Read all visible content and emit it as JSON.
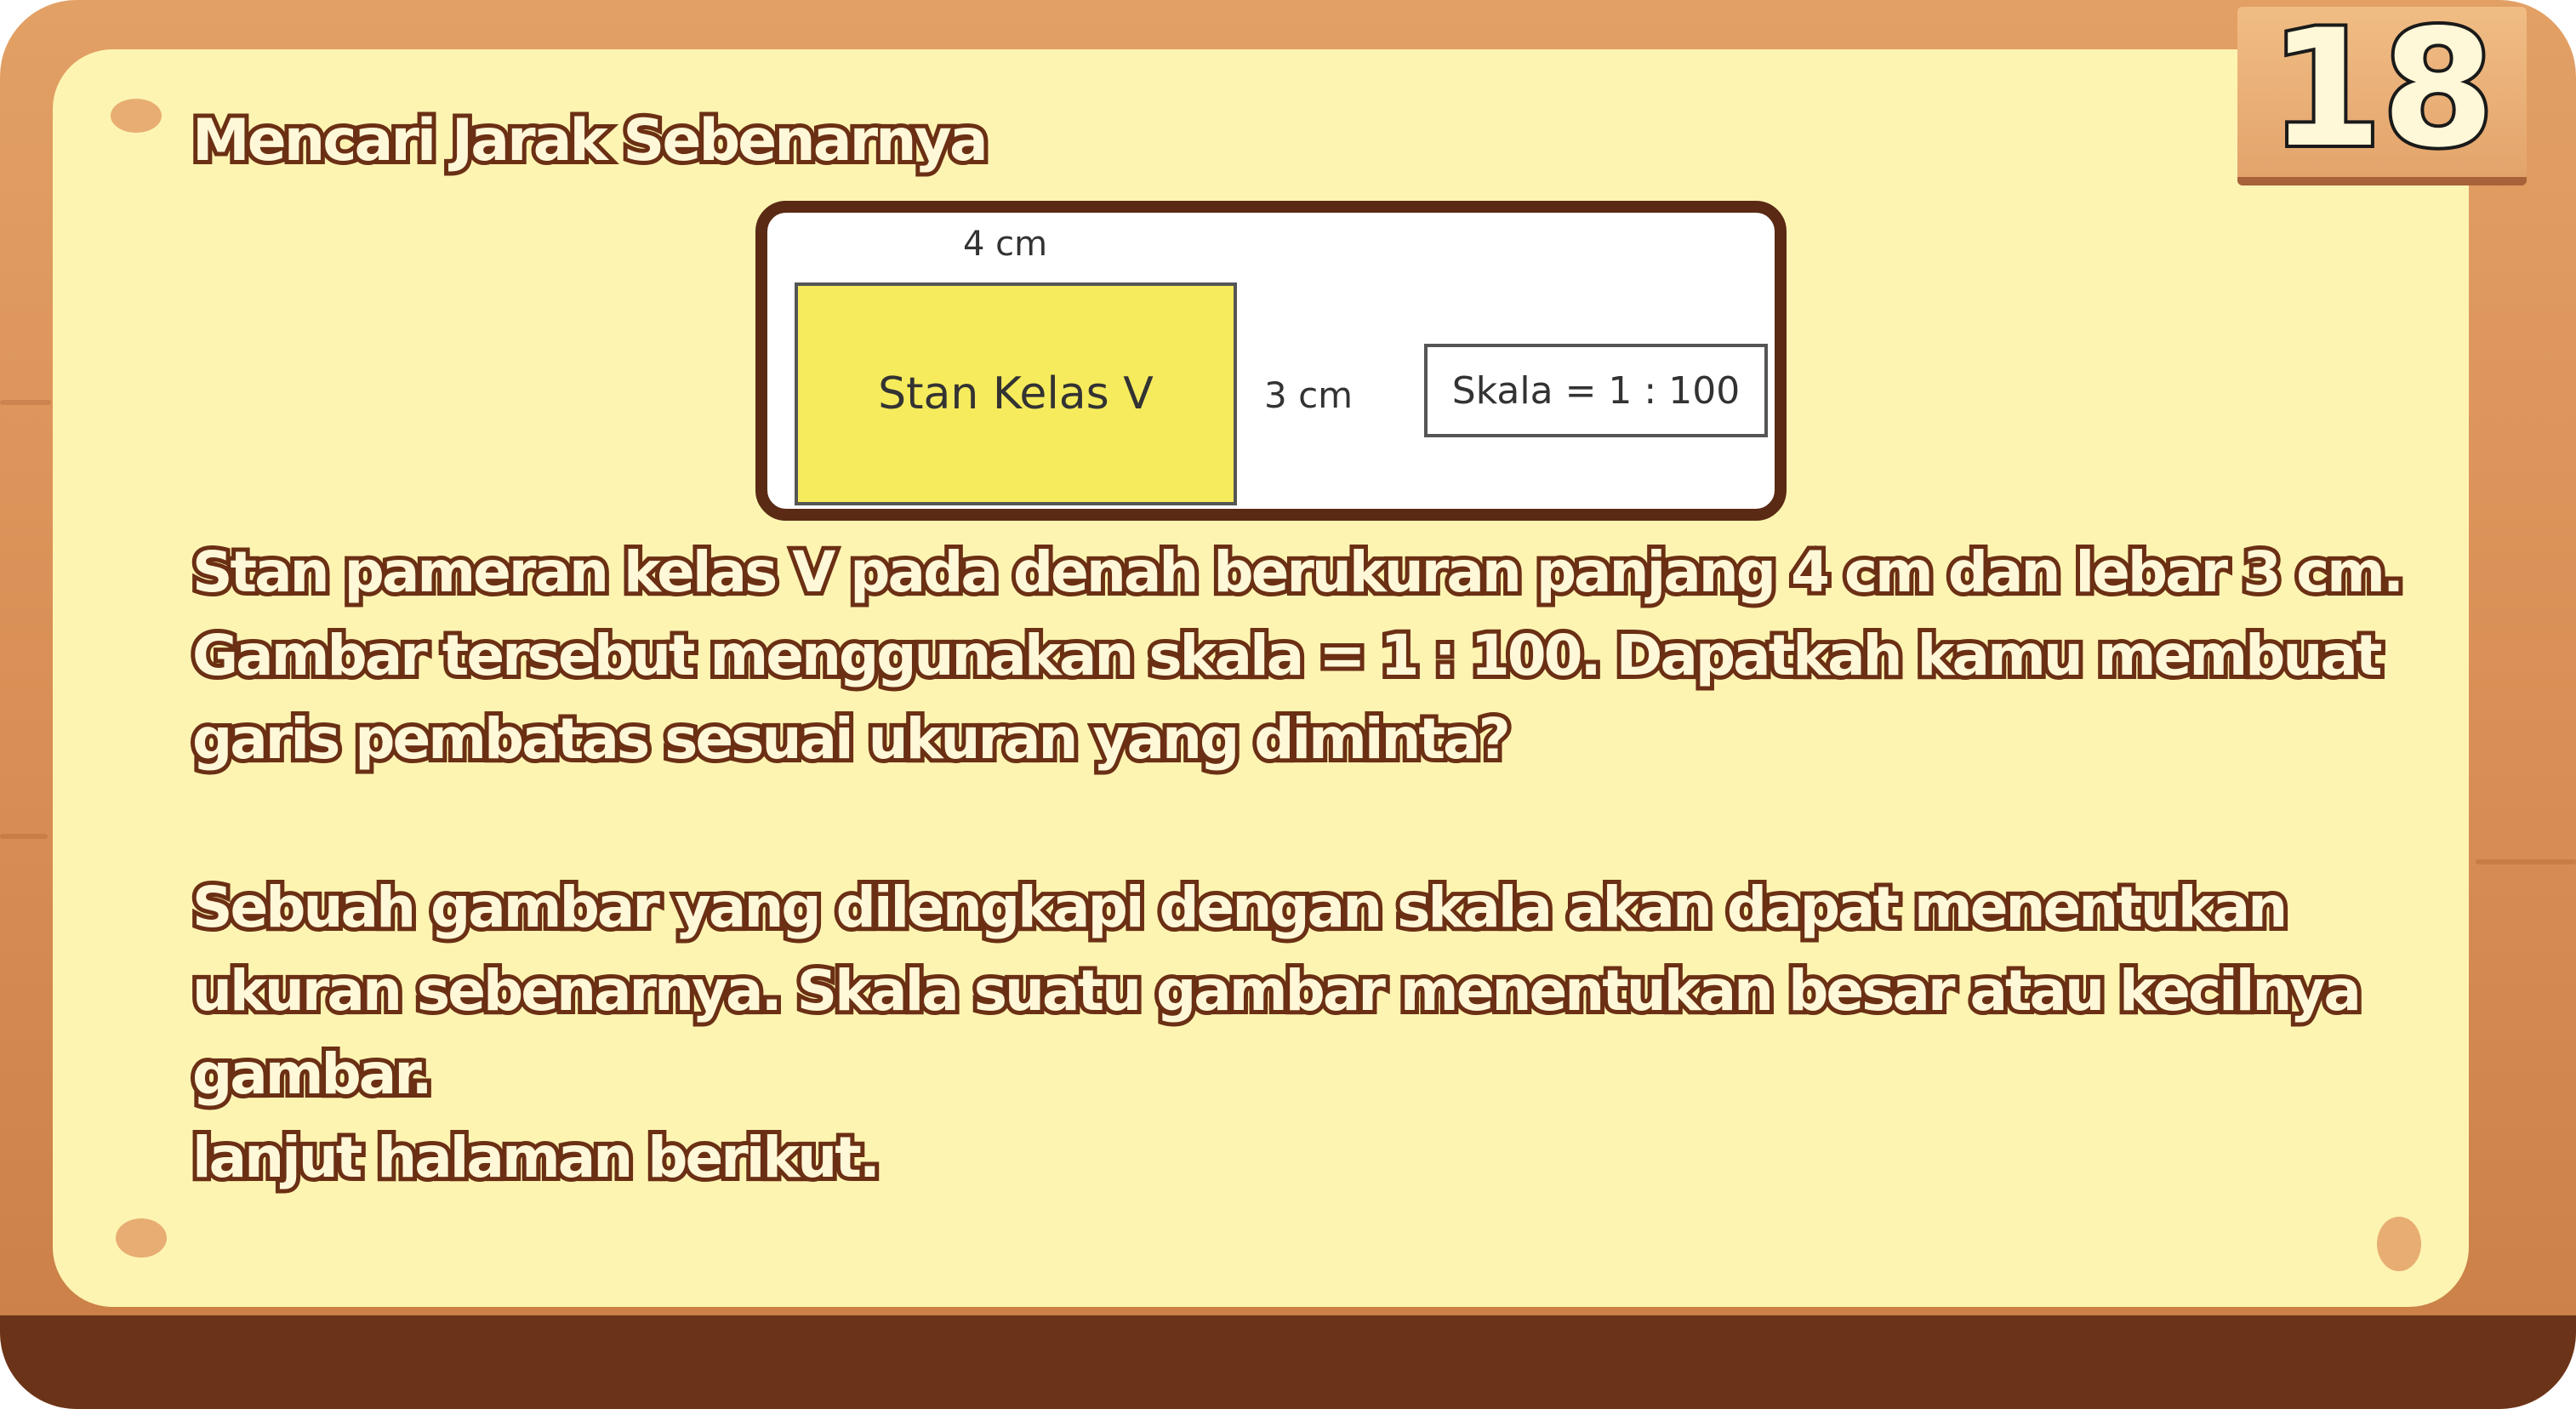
{
  "page": {
    "number": "18",
    "title": "Mencari Jarak Sebenarnya"
  },
  "diagram": {
    "length_label": "4 cm",
    "width_label": "3 cm",
    "stall_label": "Stan Kelas V",
    "scale_label": "Skala = 1 : 100"
  },
  "content": {
    "paragraph1": "Stan pameran kelas V pada denah berukuran panjang 4 cm dan lebar 3 cm. Gambar tersebut menggunakan skala = 1 : 100. Dapatkah kamu membuat garis pembatas sesuai ukuran yang diminta?",
    "paragraph2": "Sebuah gambar yang dilengkapi dengan skala akan dapat menentukan ukuran sebenarnya. Skala suatu gambar menentukan besar atau kecilnya gambar.",
    "paragraph3": "lanjut halaman berikut."
  },
  "colors": {
    "wood": "#d98f55",
    "paper": "#fdf4b2",
    "text_fill": "#fff8d8",
    "text_outline": "#6b2f14",
    "stall_fill": "#f6eb5c"
  }
}
